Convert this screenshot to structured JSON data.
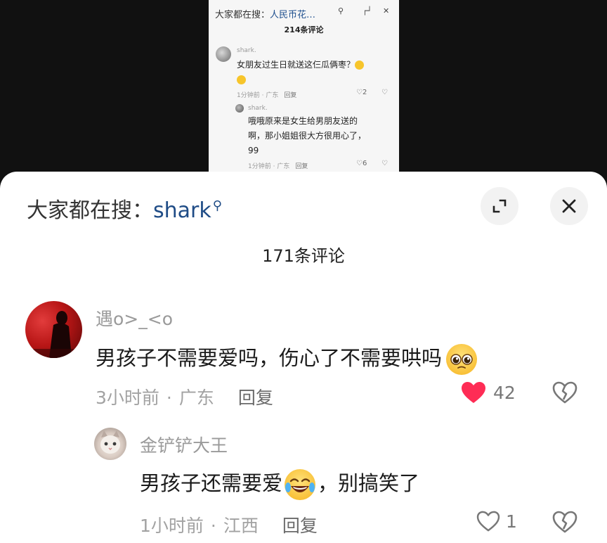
{
  "inset": {
    "search_prefix": "大家都在搜：",
    "search_query": "人民币花…",
    "comment_count": "214条评论",
    "comment": {
      "author": "shark.",
      "text": "女朋友过生日就送这仨瓜俩枣？",
      "time": "1分钟前",
      "location": "广东",
      "reply_label": "回复",
      "likes": "2"
    },
    "reply": {
      "author": "shark.",
      "text_lines": [
        "哦哦原来是女生给男朋友送的",
        "啊，那小姐姐很大方很用心了，",
        "99"
      ],
      "time": "1分钟前",
      "location": "广东",
      "reply_label": "回复",
      "likes": "6"
    }
  },
  "header": {
    "search_prefix": "大家都在搜：",
    "search_keyword": "shark",
    "search_icon": "search-icon",
    "expand_icon": "expand-icon",
    "close_icon": "close-icon"
  },
  "comment_count": "171条评论",
  "comment": {
    "author": "遇o>_<o",
    "text": "男孩子不需要爱吗，伤心了不需要哄吗",
    "time": "3小时前",
    "separator": "·",
    "location": "广东",
    "reply_label": "回复",
    "likes": "42",
    "liked": true,
    "like_color": "#fe2c55"
  },
  "reply": {
    "author": "金铲铲大王",
    "text_before": "男孩子还需要爱",
    "text_after": "，别搞笑了",
    "time": "1小时前",
    "separator": "·",
    "location": "江西",
    "reply_label": "回复",
    "likes": "1",
    "liked": false
  }
}
